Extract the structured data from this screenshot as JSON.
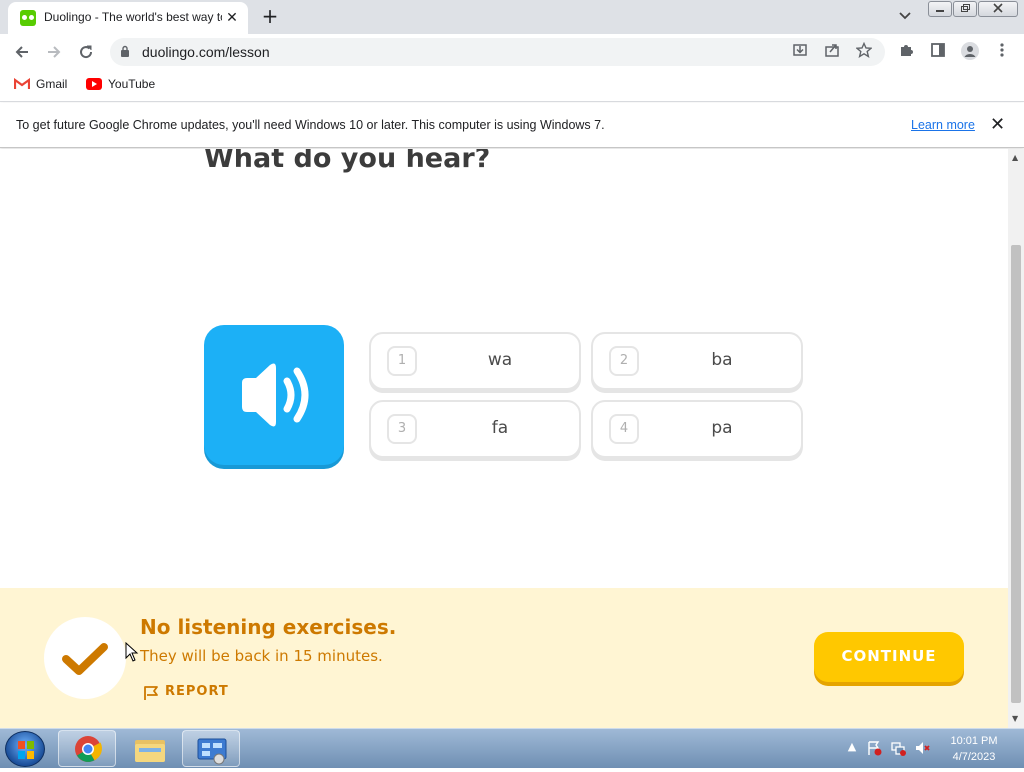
{
  "browser": {
    "tab_title": "Duolingo - The world's best way to learn a language",
    "tab_close": "✕",
    "new_tab": "+",
    "url": "duolingo.com/lesson",
    "bookmarks": [
      {
        "label": "Gmail",
        "icon": "gmail-icon"
      },
      {
        "label": "YouTube",
        "icon": "youtube-icon"
      }
    ],
    "infobar": {
      "message": "To get future Google Chrome updates, you'll need Windows 10 or later. This computer is using Windows 7.",
      "link": "Learn more",
      "close": "✕"
    }
  },
  "lesson": {
    "prompt": "What do you hear?",
    "choices": [
      {
        "num": "1",
        "text": "wa"
      },
      {
        "num": "2",
        "text": "ba"
      },
      {
        "num": "3",
        "text": "fa"
      },
      {
        "num": "4",
        "text": "pa"
      }
    ],
    "feedback": {
      "title": "No listening exercises.",
      "subtitle": "They will be back in 15 minutes.",
      "report": "REPORT"
    },
    "continue_label": "CONTINUE"
  },
  "taskbar": {
    "time": "10:01 PM",
    "date": "4/7/2023"
  },
  "colors": {
    "speaker": "#1cb0f6",
    "feedback_bg": "#fff5d3",
    "feedback_text": "#cd7900",
    "continue": "#ffc800"
  }
}
